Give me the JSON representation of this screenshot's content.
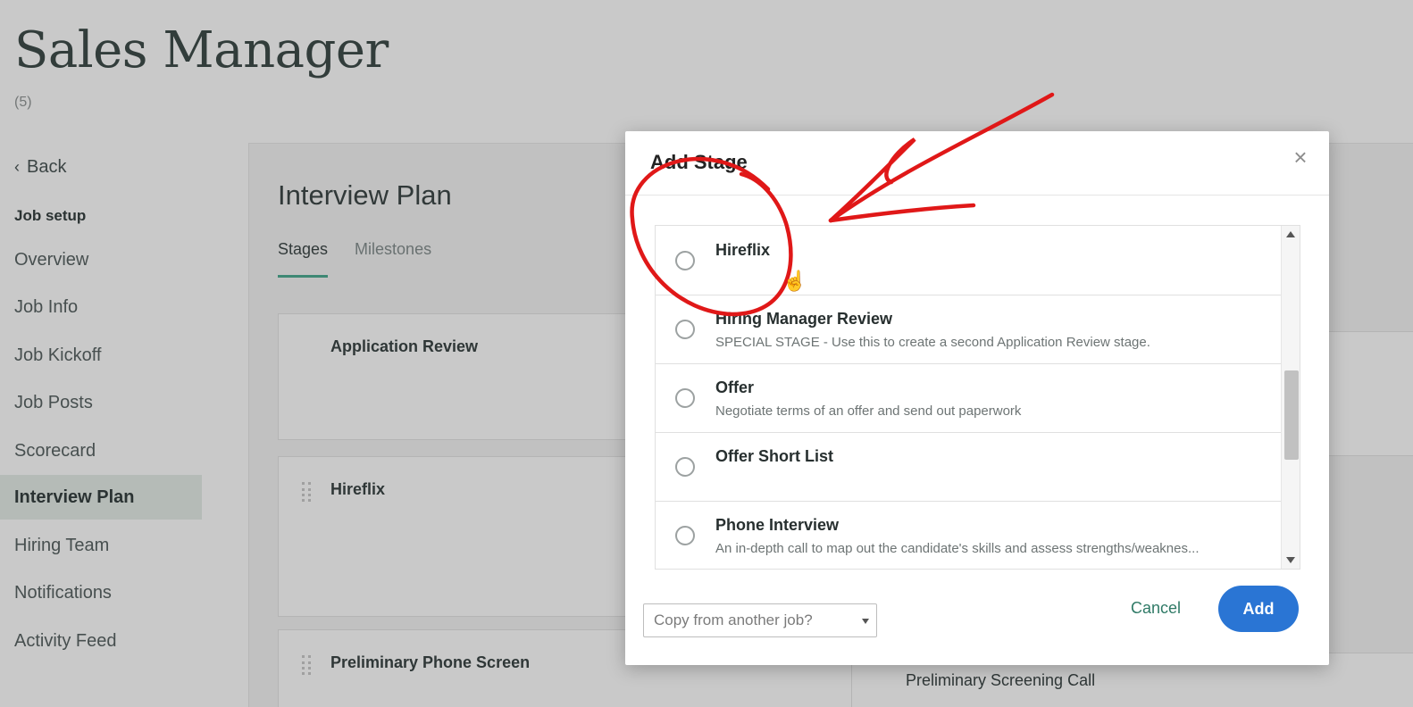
{
  "page": {
    "job_title": "Sales Manager",
    "job_count": "(5)"
  },
  "nav": {
    "back_label": "Back",
    "section_heading": "Job setup",
    "items": [
      {
        "label": "Overview"
      },
      {
        "label": "Job Info"
      },
      {
        "label": "Job Kickoff"
      },
      {
        "label": "Job Posts"
      },
      {
        "label": "Scorecard"
      },
      {
        "label": "Interview Plan",
        "active": true
      },
      {
        "label": "Hiring Team"
      },
      {
        "label": "Notifications"
      },
      {
        "label": "Activity Feed"
      }
    ]
  },
  "main": {
    "title": "Interview Plan",
    "tabs": [
      {
        "label": "Stages",
        "active": true
      },
      {
        "label": "Milestones"
      }
    ],
    "stages": [
      {
        "name": "Application Review"
      },
      {
        "name": "Hireflix"
      },
      {
        "name": "Preliminary Phone Screen"
      }
    ],
    "right_card_text": "Preliminary Screening Call"
  },
  "modal": {
    "title": "Add Stage",
    "close_icon": "close-icon",
    "options": [
      {
        "name": "Hireflix",
        "description": ""
      },
      {
        "name": "Hiring Manager Review",
        "description": "SPECIAL STAGE - Use this to create a second Application Review stage."
      },
      {
        "name": "Offer",
        "description": "Negotiate terms of an offer and send out paperwork"
      },
      {
        "name": "Offer Short List",
        "description": ""
      },
      {
        "name": "Phone Interview",
        "description": "An in-depth call to map out the candidate's skills and assess strengths/weaknes..."
      }
    ],
    "copy_placeholder": "Copy from another job?",
    "cancel_label": "Cancel",
    "add_label": "Add"
  },
  "colors": {
    "accent_green": "#3fa58a",
    "primary_blue": "#2a75d4",
    "annotation_red": "#e01818"
  }
}
